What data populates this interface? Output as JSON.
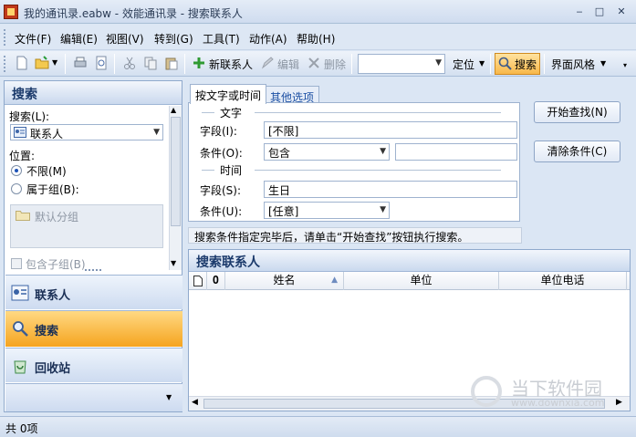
{
  "window": {
    "title": "我的通讯录.eabw - 效能通讯录 - 搜索联系人",
    "min": "‒",
    "max": "□",
    "close": "✕"
  },
  "menu": [
    "文件(F)",
    "编辑(E)",
    "视图(V)",
    "转到(G)",
    "工具(T)",
    "动作(A)",
    "帮助(H)"
  ],
  "toolbar": {
    "new_contact": "新联系人",
    "edit": "编辑",
    "delete": "删除",
    "locate": "定位",
    "search": "搜索",
    "theme": "界面风格"
  },
  "left": {
    "header": "搜索",
    "search_label": "搜索(L):",
    "search_value": "联系人",
    "position_label": "位置:",
    "radio_unlimited": "不限(M)",
    "radio_group": "属于组(B):",
    "default_group": "默认分组",
    "include_sub": "包含子组(B)"
  },
  "nav": {
    "contacts": "联系人",
    "search": "搜索",
    "recycle": "回收站"
  },
  "tabs": {
    "by_text_time": "按文字或时间",
    "other": "其他选项"
  },
  "form": {
    "section_text": "文字",
    "field_label": "字段(I):",
    "field_value": "[不限]",
    "condition_label": "条件(O):",
    "condition_value": "包含",
    "section_time": "时间",
    "time_field_label": "字段(S):",
    "time_field_value": "生日",
    "time_condition_label": "条件(U):",
    "time_condition_value": "[任意]"
  },
  "buttons": {
    "start": "开始查找(N)",
    "clear": "清除条件(C)"
  },
  "hint": "搜索条件指定完毕后，请单击“开始查找”按钮执行搜索。",
  "results": {
    "header": "搜索联系人",
    "columns": [
      "姓名",
      "单位",
      "单位电话"
    ]
  },
  "status": "共 0项",
  "watermark": {
    "name": "当下软件园",
    "url": "www.downxia.com"
  }
}
